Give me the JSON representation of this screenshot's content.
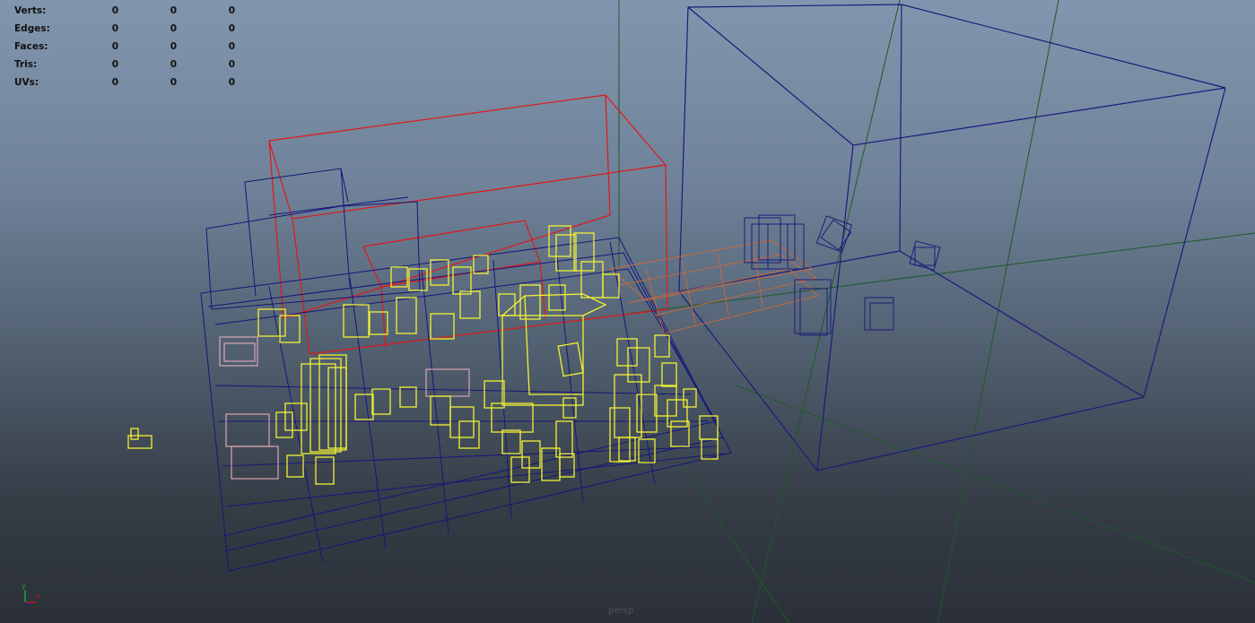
{
  "hud": {
    "rows": [
      {
        "label": "Verts:",
        "v1": "0",
        "v2": "0",
        "v3": "0"
      },
      {
        "label": "Edges:",
        "v1": "0",
        "v2": "0",
        "v3": "0"
      },
      {
        "label": "Faces:",
        "v1": "0",
        "v2": "0",
        "v3": "0"
      },
      {
        "label": "Tris:",
        "v1": "0",
        "v2": "0",
        "v3": "0"
      },
      {
        "label": "UVs:",
        "v1": "0",
        "v2": "0",
        "v3": "0"
      }
    ]
  },
  "camera": {
    "name": "persp"
  },
  "axis": {
    "y": "y",
    "x": "x"
  },
  "colors": {
    "selected": "#f2f235",
    "wire": "#17196e",
    "highlight": "#e01818",
    "orange": "#c86a3a",
    "pink": "#d8a6b6",
    "grid": "#1e5a2a"
  }
}
